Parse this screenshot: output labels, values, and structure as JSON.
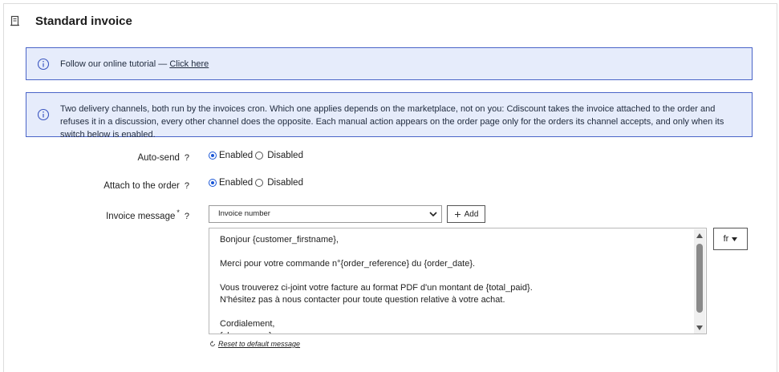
{
  "section": {
    "title": "Standard invoice",
    "icon": "document-icon"
  },
  "tutorial_alert": {
    "text": "Follow our online tutorial — ",
    "link_label": "Click here",
    "icon": "info-icon"
  },
  "channels_alert": {
    "text": "Two delivery channels, both run by the invoices cron. Which one applies depends on the marketplace, not on you: Cdiscount takes the invoice attached to the order and refuses it in a discussion, every other channel does the opposite. Each manual action appears on the order page only for the orders its channel accepts, and only when its switch below is enabled.",
    "icon": "info-icon"
  },
  "auto_send": {
    "label": "Auto-send",
    "help": "?",
    "options": [
      "Enabled",
      "Disabled"
    ],
    "selected": "Enabled"
  },
  "attach_order": {
    "label": "Attach to the order",
    "help": "?",
    "options": [
      "Enabled",
      "Disabled"
    ],
    "selected": "Enabled"
  },
  "invoice_message": {
    "label": "Invoice message",
    "required_mark": "*",
    "help": "?",
    "variable_select": "Invoice number",
    "add_label": "Add",
    "language": "fr",
    "lines": [
      "Bonjour {customer_firstname},",
      "",
      "Merci pour votre commande n°{order_reference} du {order_date}.",
      "",
      "Vous trouverez ci-joint votre facture au format PDF d'un montant de {total_paid}.",
      "N'hésitez pas à nous contacter pour toute question relative à votre achat.",
      "",
      "Cordialement,",
      "{shop_name}"
    ],
    "reset_label": "Reset to default message"
  },
  "colors": {
    "alert_bg": "#e6ecfb",
    "alert_border": "#4a64c8",
    "radio_accent": "#1a56d6"
  }
}
